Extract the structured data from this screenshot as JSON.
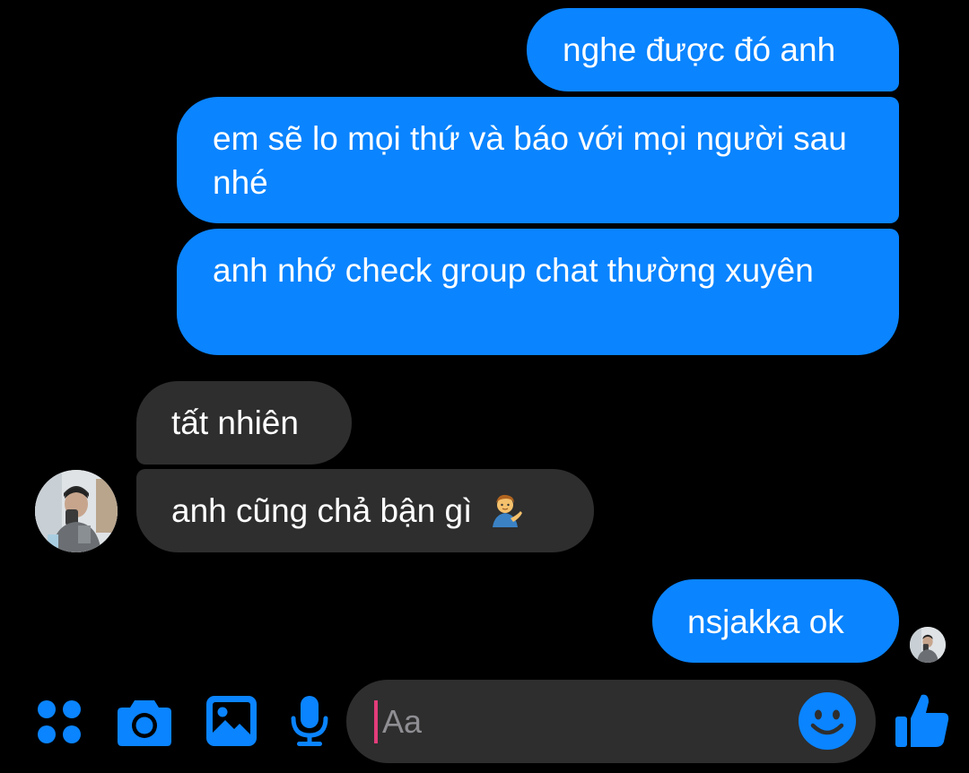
{
  "conversation": {
    "messages": [
      {
        "direction": "sent",
        "text": "nghe được đó anh"
      },
      {
        "direction": "sent",
        "text": "em sẽ lo mọi thứ và báo với mọi người sau nhé"
      },
      {
        "direction": "sent",
        "text": "anh nhớ check group chat thường xuyên"
      },
      {
        "direction": "received",
        "text": "tất nhiên"
      },
      {
        "direction": "received",
        "text": "anh cũng chả bận gì",
        "emoji": "person-tipping-hand"
      },
      {
        "direction": "sent",
        "text": "nsjakka ok"
      }
    ]
  },
  "composer": {
    "placeholder": "Aa",
    "value": ""
  },
  "toolbar": {
    "icons": [
      "grid-menu-icon",
      "camera-icon",
      "gallery-icon",
      "microphone-icon",
      "emoji-smile-icon",
      "thumbs-up-icon"
    ]
  },
  "theme": {
    "background": "#000000",
    "sent_bubble": "#0a84ff",
    "received_bubble": "#2e2e2e",
    "accent": "#0a84ff",
    "caret": "#e33d7a"
  }
}
